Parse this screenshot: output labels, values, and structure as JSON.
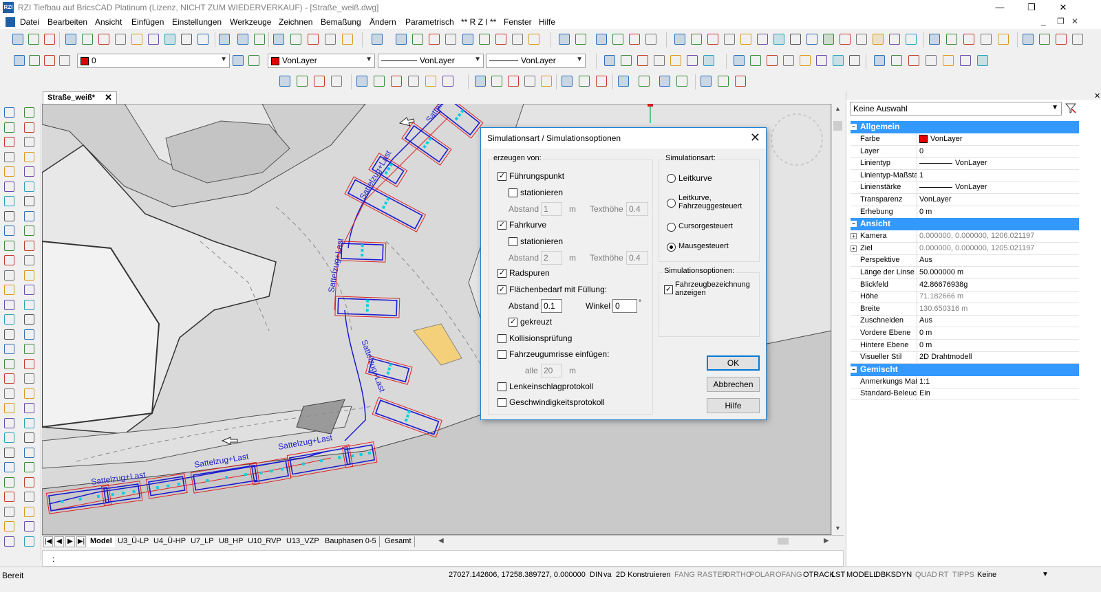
{
  "window": {
    "title": "RZI Tiefbau auf BricsCAD Platinum (Lizenz, NICHT ZUM WIEDERVERKAUF) - [Straße_weiß.dwg]",
    "minimize": "—",
    "restore": "❐",
    "close": "✕",
    "mdi_minimize": "_",
    "mdi_restore": "❐",
    "mdi_close": "✕"
  },
  "menu": [
    "Datei",
    "Bearbeiten",
    "Ansicht",
    "Einfügen",
    "Einstellungen",
    "Werkzeuge",
    "Zeichnen",
    "Bemaßung",
    "Ändern",
    "Parametrisch",
    "** R Z I **",
    "Fenster",
    "Hilfe"
  ],
  "layer_toolbar": {
    "layer_value": "0",
    "color_value": "VonLayer",
    "linetype_value": "VonLayer",
    "lineweight_value": "VonLayer"
  },
  "doc_tab": {
    "label": "Straße_weiß*",
    "close": "✕"
  },
  "drawing": {
    "labels": [
      "Sattelzug+Last",
      "Sattelzug+Last",
      "Sattelzug+Last",
      "Sattelzug+Last",
      "Sattelzug+Last",
      "Sattelzug+Last",
      "Sattelzug+Last"
    ]
  },
  "layout_tabs": [
    "Model",
    "U3_Ü-LP",
    "U4_Ü-HP",
    "U7_LP",
    "U8_HP",
    "U10_RVP",
    "U13_VZP",
    "Bauphasen 0-5",
    "Gesamt"
  ],
  "command_line": {
    "prompt": ":"
  },
  "status": {
    "ready": "Bereit",
    "coords": "27027.142606, 17258.389727, 0.000000",
    "items": [
      {
        "label": "DIN",
        "on": true
      },
      {
        "label": "va",
        "on": true
      },
      {
        "label": "2D Konstruieren",
        "on": true
      },
      {
        "label": "FANG",
        "on": false
      },
      {
        "label": "RASTER",
        "on": false
      },
      {
        "label": "ORTHO",
        "on": false
      },
      {
        "label": "POLAR",
        "on": false
      },
      {
        "label": "OFANG",
        "on": false
      },
      {
        "label": "OTRACK",
        "on": true
      },
      {
        "label": "LST",
        "on": true
      },
      {
        "label": "MODELL",
        "on": true
      },
      {
        "label": "DBKS",
        "on": true
      },
      {
        "label": "DYN",
        "on": true
      },
      {
        "label": "QUAD",
        "on": false
      },
      {
        "label": "RT",
        "on": false
      },
      {
        "label": "TIPPS",
        "on": false
      },
      {
        "label": "Keine",
        "on": true
      }
    ]
  },
  "properties": {
    "selection": "Keine Auswahl",
    "sections": [
      {
        "name": "Allgemein",
        "rows": [
          {
            "label": "Farbe",
            "value": "VonLayer",
            "kind": "color"
          },
          {
            "label": "Layer",
            "value": "0"
          },
          {
            "label": "Linientyp",
            "value": "VonLayer",
            "kind": "line"
          },
          {
            "label": "Linientyp-Maßstab",
            "value": "1"
          },
          {
            "label": "Linienstärke",
            "value": "VonLayer",
            "kind": "line"
          },
          {
            "label": "Transparenz",
            "value": "VonLayer"
          },
          {
            "label": "Erhebung",
            "value": "0 m"
          }
        ]
      },
      {
        "name": "Ansicht",
        "rows": [
          {
            "label": "Kamera",
            "value": "0.000000, 0.000000, 1206.021197",
            "grey": true,
            "expandable": true
          },
          {
            "label": "Ziel",
            "value": "0.000000, 0.000000, 1205.021197",
            "grey": true,
            "expandable": true
          },
          {
            "label": "Perspektive",
            "value": "Aus"
          },
          {
            "label": "Länge der Linse",
            "value": "50.000000 m"
          },
          {
            "label": "Blickfeld",
            "value": "42.86676938g"
          },
          {
            "label": "Höhe",
            "value": "71.182666 m",
            "grey": true
          },
          {
            "label": "Breite",
            "value": "130.650316 m",
            "grey": true
          },
          {
            "label": "Zuschneiden",
            "value": "Aus"
          },
          {
            "label": "Vordere Ebene",
            "value": "0 m"
          },
          {
            "label": "Hintere Ebene",
            "value": "0 m"
          },
          {
            "label": "Visueller Stil",
            "value": "2D Drahtmodell"
          }
        ]
      },
      {
        "name": "Gemischt",
        "rows": [
          {
            "label": "Anmerkungs Maßstab",
            "value": "1:1"
          },
          {
            "label": "Standard-Beleuchtung",
            "value": "Ein"
          }
        ]
      }
    ]
  },
  "dialog": {
    "title": "Simulationsart / Simulationsoptionen",
    "close": "✕",
    "group_source": "erzeugen von:",
    "fuehrungspunkt": {
      "label": "Führungspunkt",
      "checked": true
    },
    "stationieren1": {
      "label": "stationieren",
      "checked": false
    },
    "abstand1": {
      "label": "Abstand",
      "value": "1",
      "unit": "m"
    },
    "texthoehe1": {
      "label": "Texthöhe",
      "value": "0.4"
    },
    "fahrkurve": {
      "label": "Fahrkurve",
      "checked": true
    },
    "stationieren2": {
      "label": "stationieren",
      "checked": false
    },
    "abstand2": {
      "label": "Abstand",
      "value": "2",
      "unit": "m"
    },
    "texthoehe2": {
      "label": "Texthöhe",
      "value": "0.4"
    },
    "radspuren": {
      "label": "Radspuren",
      "checked": true
    },
    "flaechenbedarf": {
      "label": "Flächenbedarf mit Füllung:",
      "checked": true
    },
    "abstand3": {
      "label": "Abstand",
      "value": "0.1"
    },
    "winkel": {
      "label": "Winkel",
      "value": "0",
      "unit": "°"
    },
    "gekreuzt": {
      "label": "gekreuzt",
      "checked": true
    },
    "kollision": {
      "label": "Kollisionsprüfung",
      "checked": false
    },
    "umrisse": {
      "label": "Fahrzeugumrisse einfügen:",
      "checked": false
    },
    "alle": {
      "label": "alle",
      "value": "20",
      "unit": "m"
    },
    "lenkeinschlag": {
      "label": "Lenkeinschlagprotokoll",
      "checked": false
    },
    "geschwindigkeit": {
      "label": "Geschwindigkeitsprotokoll",
      "checked": false
    },
    "group_simart": "Simulationsart:",
    "radio_leitkurve": {
      "label": "Leitkurve",
      "checked": false
    },
    "radio_leitkurve_fahrzeug": {
      "label": "Leitkurve,\nFahrzeuggesteuert",
      "line1": "Leitkurve,",
      "line2": "Fahrzeuggesteuert",
      "checked": false
    },
    "radio_cursor": {
      "label": "Cursorgesteuert",
      "checked": false
    },
    "radio_maus": {
      "label": "Mausgesteuert",
      "checked": true
    },
    "group_simopt": "Simulationsoptionen:",
    "fahrzeugbez": {
      "line1": "Fahrzeugbezeichnung",
      "line2": "anzeigen",
      "checked": true
    },
    "ok": "OK",
    "cancel": "Abbrechen",
    "help": "Hilfe"
  },
  "colors": {
    "accent": "#3399ff",
    "vehicle": "#1a1ad0",
    "envelope": "#e02020",
    "marker": "#00d0e0",
    "highlight": "#f5d07a"
  }
}
